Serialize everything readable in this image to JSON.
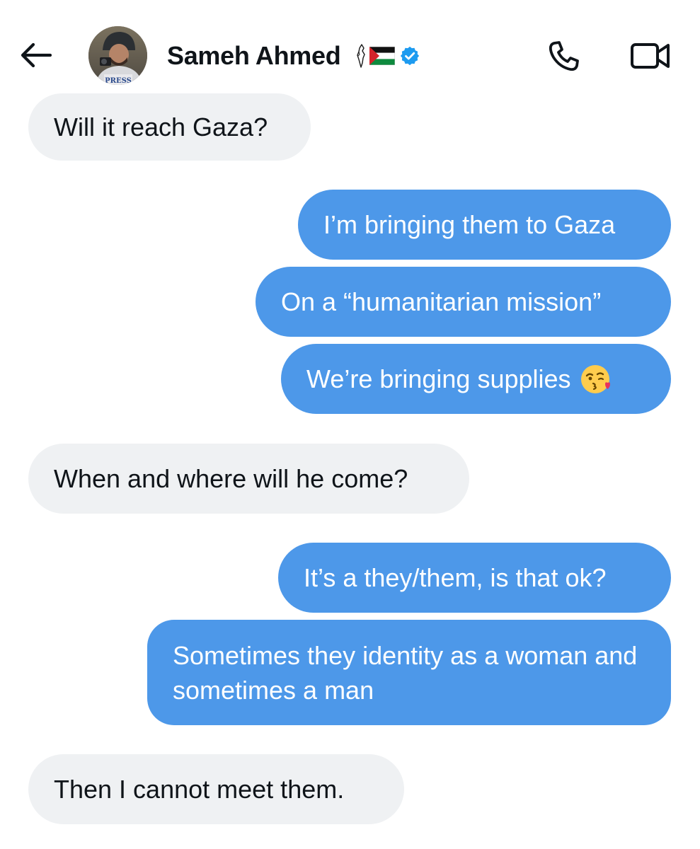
{
  "header": {
    "contact_name": "Sameh Ahmed",
    "avatar_badge_text": "PRESS",
    "name_emojis": [
      "map-of-palestine-emoji",
      "palestine-flag-emoji"
    ],
    "verified": true,
    "icons": {
      "back": "arrow-left-icon",
      "call": "phone-icon",
      "video": "video-camera-icon",
      "verified": "verified-badge-icon"
    },
    "colors": {
      "verified_badge": "#1d9bf0"
    }
  },
  "messages": [
    {
      "direction": "incoming",
      "text": "Will it reach Gaza?"
    },
    {
      "direction": "outgoing",
      "text": "I’m bringing them to Gaza"
    },
    {
      "direction": "outgoing",
      "text": "On a “humanitarian mission”"
    },
    {
      "direction": "outgoing",
      "text": "We’re bringing supplies",
      "emoji": "face-blowing-a-kiss-emoji"
    },
    {
      "direction": "incoming",
      "text": "When and where will he come?"
    },
    {
      "direction": "outgoing",
      "text": "It’s a they/them, is that ok?"
    },
    {
      "direction": "outgoing",
      "text": "Sometimes they identity as a woman and sometimes a man"
    },
    {
      "direction": "incoming",
      "text": "Then I cannot meet them."
    }
  ],
  "colors": {
    "incoming_bubble": "#eff1f3",
    "outgoing_bubble": "#4d98e9",
    "outgoing_text": "#ffffff",
    "incoming_text": "#0f1419"
  }
}
